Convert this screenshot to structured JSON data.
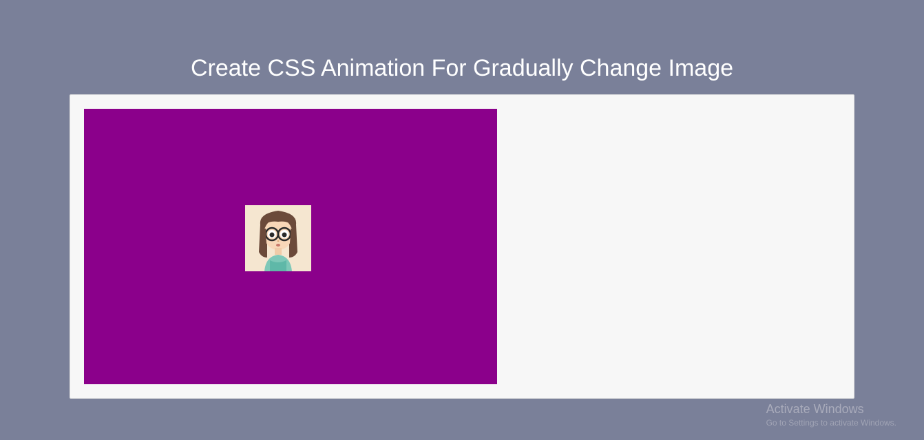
{
  "page": {
    "title": "Create CSS Animation For Gradually Change Image"
  },
  "demo": {
    "box_color": "#8b008b",
    "avatar": {
      "name": "cartoon-girl-avatar",
      "bg_color": "#f5e6d0"
    }
  },
  "watermark": {
    "title": "Activate Windows",
    "subtitle": "Go to Settings to activate Windows."
  }
}
